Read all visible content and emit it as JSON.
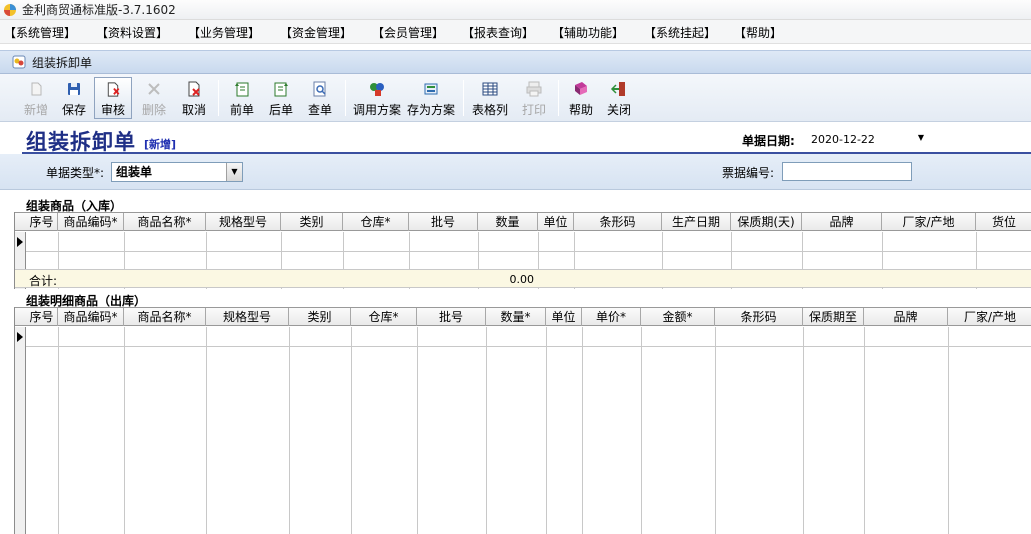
{
  "window": {
    "title": "金利商贸通标准版-3.7.1602"
  },
  "menu": [
    "【系统管理】",
    "【资料设置】",
    "【业务管理】",
    "【资金管理】",
    "【会员管理】",
    "【报表查询】",
    "【辅助功能】",
    "【系统挂起】",
    "【帮助】"
  ],
  "panel": {
    "title": "组装拆卸单"
  },
  "toolbar": {
    "new": "新增",
    "save": "保存",
    "audit": "审核",
    "delete": "删除",
    "cancel": "取消",
    "prev": "前单",
    "next": "后单",
    "find": "查单",
    "load_scheme": "调用方案",
    "save_scheme": "存为方案",
    "columns": "表格列",
    "print": "打印",
    "help": "帮助",
    "close": "关闭"
  },
  "form": {
    "title": "组装拆卸单",
    "mode_tag": "[新增]",
    "date_label": "单据日期:",
    "date_value": "2020-12-22",
    "type_label": "单据类型*:",
    "type_value": "组装单",
    "no_label": "票据编号:",
    "no_value": ""
  },
  "inbound": {
    "title": "组装商品（入库）",
    "columns": [
      "序号",
      "商品编码*",
      "商品名称*",
      "规格型号",
      "类别",
      "仓库*",
      "批号",
      "数量",
      "单位",
      "条形码",
      "生产日期",
      "保质期(天)",
      "品牌",
      "厂家/产地",
      "货位"
    ],
    "sum_label": "合计:",
    "sum_qty": "0.00"
  },
  "outbound": {
    "title": "组装明细商品（出库）",
    "columns": [
      "序号",
      "商品编码*",
      "商品名称*",
      "规格型号",
      "类别",
      "仓库*",
      "批号",
      "数量*",
      "单位",
      "单价*",
      "金额*",
      "条形码",
      "保质期至",
      "品牌",
      "厂家/产地"
    ]
  },
  "colors": {
    "title_blue": "#1f2f86",
    "sum_row": "#fbf8e3",
    "panel_blue": "#c9d9ee"
  }
}
